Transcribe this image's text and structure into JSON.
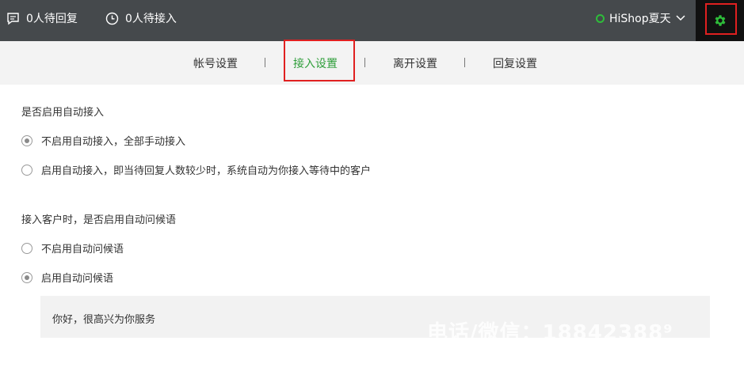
{
  "topbar": {
    "pending_reply": "0人待回复",
    "pending_accept": "0人待接入",
    "user_name": "HiShop夏天",
    "online_color": "#2ebd3a",
    "icons": [
      "chat-icon",
      "clock-icon",
      "chevron-down-icon",
      "gear-icon"
    ]
  },
  "tabs": [
    {
      "label": "帐号设置",
      "active": false
    },
    {
      "label": "接入设置",
      "active": true
    },
    {
      "label": "离开设置",
      "active": false
    },
    {
      "label": "回复设置",
      "active": false
    }
  ],
  "auto_accept": {
    "title": "是否启用自动接入",
    "options": [
      {
        "label": "不启用自动接入，全部手动接入",
        "checked": true
      },
      {
        "label": "启用自动接入，即当待回复人数较少时，系统自动为你接入等待中的客户",
        "checked": false
      }
    ]
  },
  "auto_greeting": {
    "title": "接入客户时，是否启用自动问候语",
    "options": [
      {
        "label": "不启用自动问候语",
        "checked": false
      },
      {
        "label": "启用自动问候语",
        "checked": true
      }
    ],
    "message": "你好，很高兴为你服务"
  },
  "watermark": "电话/微信：18842388⁹",
  "colors": {
    "topbar": "#45494c",
    "accent": "#2e9e3a",
    "highlight": "#e02020"
  }
}
